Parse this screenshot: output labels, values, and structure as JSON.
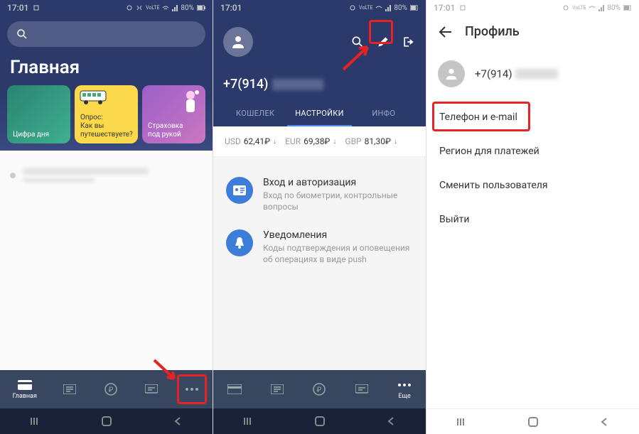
{
  "status": {
    "time": "17:01",
    "battery": "80%"
  },
  "phone1": {
    "title": "Главная",
    "cards": [
      {
        "label": "Цифра дня"
      },
      {
        "label": "Опрос:\nКак вы\nпутешествуете?"
      },
      {
        "label": "Страховка\nпод рукой"
      }
    ],
    "nav": {
      "home": "Главная",
      "more": "Еще"
    }
  },
  "phone2": {
    "phone": "+7(914)",
    "tabs": {
      "wallet": "КОШЕЛЕК",
      "settings": "НАСТРОЙКИ",
      "info": "ИНФО"
    },
    "rates": [
      {
        "code": "USD",
        "value": "62,41₽"
      },
      {
        "code": "EUR",
        "value": "69,38₽"
      },
      {
        "code": "GBP",
        "value": "81,30₽"
      }
    ],
    "settings": [
      {
        "title": "Вход и авторизация",
        "sub": "Вход по биометрии, контрольные вопросы"
      },
      {
        "title": "Уведомления",
        "sub": "Коды подтверждения и оповещения об операциях в виде push"
      }
    ],
    "nav_more": "Еще"
  },
  "phone3": {
    "title": "Профиль",
    "phone": "+7(914)",
    "menu": {
      "phone_email": "Телефон и e-mail",
      "region": "Регион для платежей",
      "switch_user": "Сменить пользователя",
      "logout": "Выйти"
    }
  }
}
